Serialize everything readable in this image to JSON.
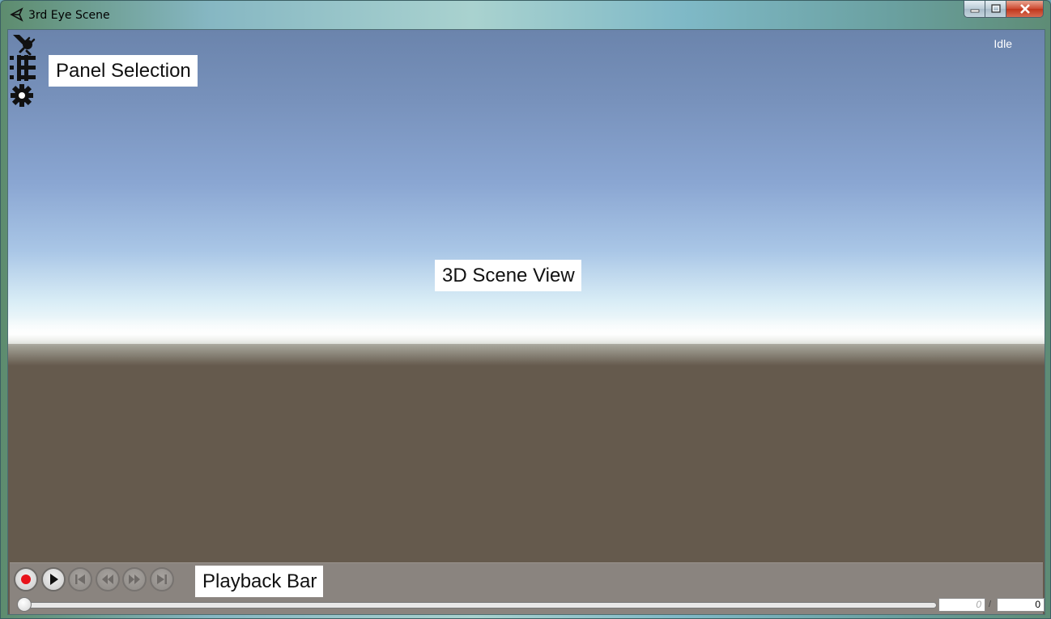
{
  "window": {
    "title": "3rd Eye Scene",
    "icon": "unity-icon",
    "controls": [
      "minimize-icon",
      "maximize-icon",
      "close-icon"
    ]
  },
  "status": {
    "text": "Idle"
  },
  "side_toolbar": {
    "icons": [
      "connection-icon",
      "list-icon",
      "gear-icon"
    ]
  },
  "labels": {
    "panel_selection": "Panel Selection",
    "scene_view": "3D Scene View",
    "playback_bar": "Playback Bar"
  },
  "playback": {
    "buttons": [
      "record-icon",
      "play-icon",
      "skip-to-start-icon",
      "step-back-icon",
      "step-forward-icon",
      "skip-to-end-icon"
    ],
    "slider_progress": 0,
    "current_frame": "0",
    "separator": "/",
    "total_frames": "0"
  },
  "colors": {
    "sky_top": "#6b84ac",
    "ground": "#655a4d",
    "playback_bar": "#8a847f",
    "record_red": "#e8121a"
  }
}
